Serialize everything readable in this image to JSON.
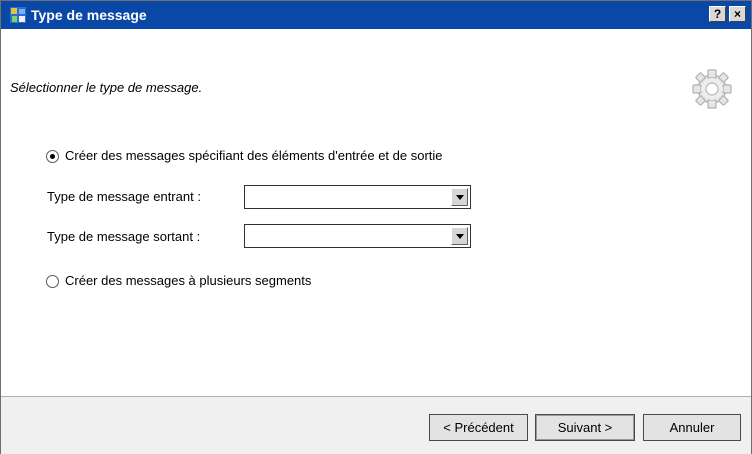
{
  "window": {
    "title": "Type de message",
    "help_label": "?",
    "close_label": "×"
  },
  "header": {
    "subtitle": "Sélectionner le type de message."
  },
  "options": {
    "io_radio_label": "Créer des messages spécifiant des éléments d'entrée et de sortie",
    "io_selected": true,
    "input_type_label": "Type de message entrant :",
    "input_type_value": "",
    "output_type_label": "Type de message sortant :",
    "output_type_value": "",
    "multi_radio_label": "Créer des messages à plusieurs segments",
    "multi_selected": false
  },
  "buttons": {
    "previous": "< Précédent",
    "next": "Suivant >",
    "cancel": "Annuler"
  },
  "colors": {
    "titlebar": "#0a48a8",
    "footer_bg": "#f0f0f0"
  }
}
